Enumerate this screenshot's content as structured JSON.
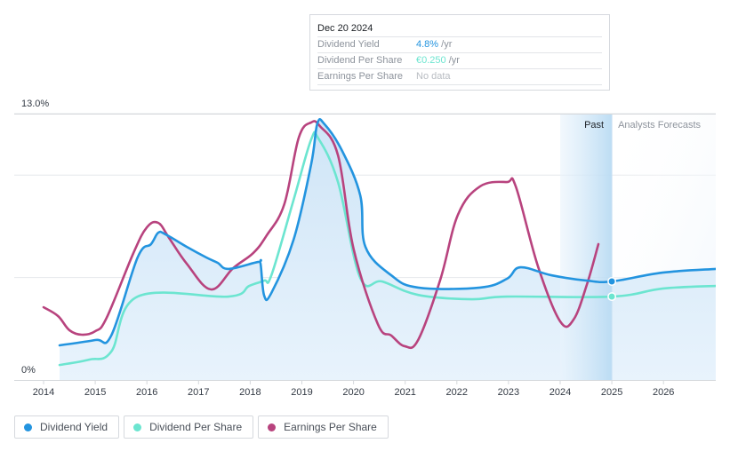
{
  "tooltip": {
    "date": "Dec 20 2024",
    "rows": [
      {
        "label": "Dividend Yield",
        "value": "4.8%",
        "suffix": " /yr",
        "color": "#2394df"
      },
      {
        "label": "Dividend Per Share",
        "value": "€0.250",
        "suffix": " /yr",
        "color": "#6ce5d0"
      },
      {
        "label": "Earnings Per Share",
        "value": "No data",
        "suffix": "",
        "color": "#b8bcc2"
      }
    ]
  },
  "legend": [
    {
      "label": "Dividend Yield",
      "color": "#2394df"
    },
    {
      "label": "Dividend Per Share",
      "color": "#6ce5d0"
    },
    {
      "label": "Earnings Per Share",
      "color": "#b8437e"
    }
  ],
  "chart_data": {
    "type": "line",
    "title": "",
    "xlabel": "",
    "ylabel": "",
    "ylim": [
      0,
      13.0
    ],
    "xlim": [
      2013.85,
      2027.05
    ],
    "y_tick_labels": [
      "0%",
      "13.0%"
    ],
    "x_tick_labels": [
      "2014",
      "2015",
      "2016",
      "2017",
      "2018",
      "2019",
      "2020",
      "2021",
      "2022",
      "2023",
      "2024",
      "2025",
      "2026"
    ],
    "x_ticks": [
      2014,
      2015,
      2016,
      2017,
      2018,
      2019,
      2020,
      2021,
      2022,
      2023,
      2024,
      2025,
      2026
    ],
    "gridlines_pct": [
      13.0,
      10.0,
      5.0
    ],
    "grid": true,
    "legend_position": "bottom-left",
    "bands": [
      {
        "label": "Past",
        "from": 2024.0,
        "to": 2025.0
      },
      {
        "label": "Analysts Forecasts",
        "from": 2025.0,
        "to": 2027.05
      }
    ],
    "current_marker_x": 2025.0,
    "series": [
      {
        "name": "Dividend Yield",
        "unit": "%",
        "color": "#2394df",
        "filled": true,
        "points": [
          [
            2014.31,
            1.69
          ],
          [
            2015.0,
            1.95
          ],
          [
            2015.31,
            2.17
          ],
          [
            2015.82,
            5.98
          ],
          [
            2016.08,
            6.63
          ],
          [
            2016.22,
            7.19
          ],
          [
            2016.36,
            7.11
          ],
          [
            2016.77,
            6.5
          ],
          [
            2017.15,
            5.98
          ],
          [
            2017.37,
            5.72
          ],
          [
            2017.58,
            5.42
          ],
          [
            2018.15,
            5.76
          ],
          [
            2018.2,
            5.68
          ],
          [
            2018.27,
            4.12
          ],
          [
            2018.41,
            4.25
          ],
          [
            2018.84,
            6.85
          ],
          [
            2019.18,
            10.53
          ],
          [
            2019.3,
            12.52
          ],
          [
            2019.44,
            12.48
          ],
          [
            2019.78,
            11.18
          ],
          [
            2020.13,
            9.01
          ],
          [
            2020.23,
            6.5
          ],
          [
            2020.73,
            5.11
          ],
          [
            2021.25,
            4.51
          ],
          [
            2022.45,
            4.51
          ],
          [
            2022.97,
            4.94
          ],
          [
            2023.23,
            5.5
          ],
          [
            2023.83,
            5.11
          ],
          [
            2024.52,
            4.85
          ],
          [
            2025.0,
            4.81
          ],
          [
            2025.98,
            5.24
          ],
          [
            2027.01,
            5.42
          ]
        ]
      },
      {
        "name": "Dividend Per Share",
        "unit": "EUR",
        "color": "#6ce5d0",
        "filled": false,
        "scale_pct_per_eur": 16.28,
        "points": [
          [
            2014.31,
            0.045
          ],
          [
            2014.88,
            0.061
          ],
          [
            2015.31,
            0.085
          ],
          [
            2015.82,
            0.25
          ],
          [
            2017.58,
            0.25
          ],
          [
            2017.98,
            0.282
          ],
          [
            2018.27,
            0.298
          ],
          [
            2018.41,
            0.314
          ],
          [
            2018.84,
            0.54
          ],
          [
            2019.18,
            0.721
          ],
          [
            2019.32,
            0.724
          ],
          [
            2019.7,
            0.593
          ],
          [
            2020.13,
            0.306
          ],
          [
            2020.56,
            0.295
          ],
          [
            2021.25,
            0.255
          ],
          [
            2022.28,
            0.242
          ],
          [
            2022.97,
            0.25
          ],
          [
            2025.0,
            0.25
          ],
          [
            2025.98,
            0.274
          ],
          [
            2027.01,
            0.282
          ]
        ]
      },
      {
        "name": "Earnings Per Share",
        "unit": "index (axis %)",
        "color": "#b8437e",
        "filled": false,
        "points": [
          [
            2014.0,
            3.55
          ],
          [
            2014.28,
            3.12
          ],
          [
            2014.5,
            2.43
          ],
          [
            2014.74,
            2.21
          ],
          [
            2015.0,
            2.38
          ],
          [
            2015.22,
            3.03
          ],
          [
            2015.74,
            6.2
          ],
          [
            2016.0,
            7.45
          ],
          [
            2016.22,
            7.67
          ],
          [
            2016.43,
            6.93
          ],
          [
            2016.77,
            5.68
          ],
          [
            2017.24,
            4.42
          ],
          [
            2017.67,
            5.46
          ],
          [
            2018.06,
            6.2
          ],
          [
            2018.32,
            7.06
          ],
          [
            2018.66,
            8.58
          ],
          [
            2018.94,
            11.83
          ],
          [
            2019.18,
            12.57
          ],
          [
            2019.35,
            12.39
          ],
          [
            2019.7,
            10.96
          ],
          [
            2020.0,
            6.41
          ],
          [
            2020.47,
            2.73
          ],
          [
            2020.73,
            2.17
          ],
          [
            2020.99,
            1.65
          ],
          [
            2021.25,
            1.95
          ],
          [
            2021.68,
            4.9
          ],
          [
            2022.02,
            8.06
          ],
          [
            2022.45,
            9.45
          ],
          [
            2022.97,
            9.66
          ],
          [
            2023.14,
            9.45
          ],
          [
            2023.57,
            5.55
          ],
          [
            2024.0,
            2.86
          ],
          [
            2024.26,
            2.95
          ],
          [
            2024.52,
            4.68
          ],
          [
            2024.74,
            6.63
          ]
        ]
      }
    ]
  }
}
